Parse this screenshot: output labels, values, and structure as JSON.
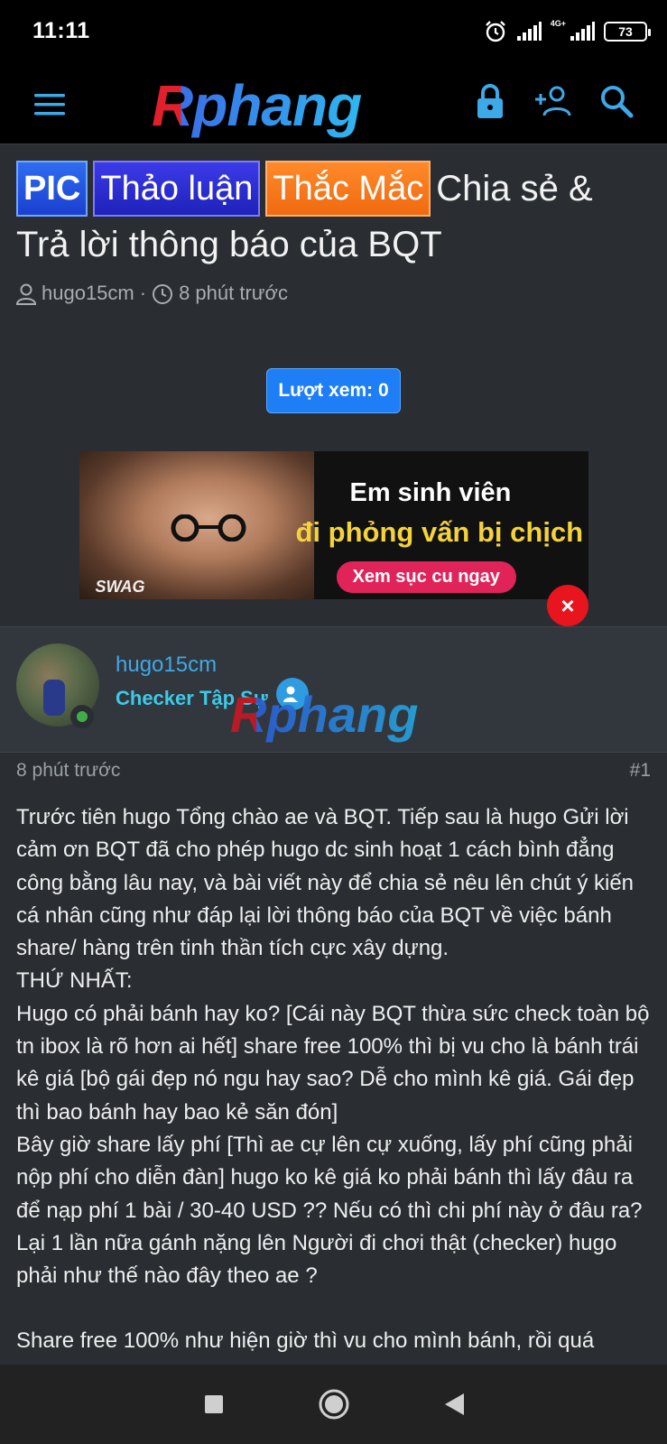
{
  "status_bar": {
    "time": "11:11",
    "network_label": "4G+",
    "battery": "73"
  },
  "app_bar": {
    "logo": "Rphang",
    "icons": [
      "menu-icon",
      "lock-icon",
      "add-user-icon",
      "search-icon"
    ]
  },
  "thread": {
    "prefixes": [
      "PIC",
      "Thảo luận",
      "Thắc Mắc"
    ],
    "title": "Chia sẻ & Trả lời thông báo của BQT",
    "author": "hugo15cm",
    "time_ago": "8 phút trước",
    "views_label": "Lượt xem: 0"
  },
  "ad": {
    "line1": "Em sinh viên",
    "line2": "đi phỏng vấn bị chịch",
    "cta": "Xem sục cu ngay",
    "brand": "SWAG",
    "close_label": "×"
  },
  "post": {
    "author": "hugo15cm",
    "role": "Checker Tập Sự",
    "watermark": "Rphang",
    "time_ago": "8 phút trước",
    "number": "#1",
    "body": [
      "Trước tiên hugo Tổng chào ae và BQT. Tiếp sau là hugo Gửi lời cảm ơn BQT đã cho phép hugo dc sinh hoạt 1 cách bình đẳng công bằng lâu nay, và bài viết này để chia sẻ nêu lên chút ý kiến cá nhân cũng như đáp lại lời thông báo của BQT về việc bánh share/ hàng trên tinh thần tích cực xây dựng.",
      "THỨ NHẤT:",
      "Hugo có phải bánh hay ko? [Cái này BQT thừa sức check toàn bộ tn ibox là rõ hơn ai hết] share free 100% thì bị vu cho là bánh trái kê giá [bộ gái đẹp nó ngu hay sao? Dễ cho mình kê giá. Gái đẹp thì bao bánh hay bao kẻ săn đón]",
      "Bây giờ share lấy phí [Thì ae cự lên cự xuống, lấy phí cũng phải nộp phí cho diễn đàn] hugo ko kê giá ko phải bánh thì lấy đâu ra để nạp phí 1 bài / 30-40 USD ?? Nếu có thì chi phí này ở đâu ra? Lại 1 lần nữa gánh nặng lên Người đi chơi thật (checker) hugo phải như thế nào đây theo ae ?",
      "Share free 100% như hiện giờ thì vu cho mình bánh, rồi quá"
    ]
  },
  "nav_bar": {
    "buttons": [
      "recent-apps-icon",
      "home-icon",
      "back-icon"
    ]
  },
  "colors": {
    "accent": "#1e7ef5",
    "link": "#3ea9e8",
    "background": "#2a2e33",
    "close": "#e8141e"
  }
}
